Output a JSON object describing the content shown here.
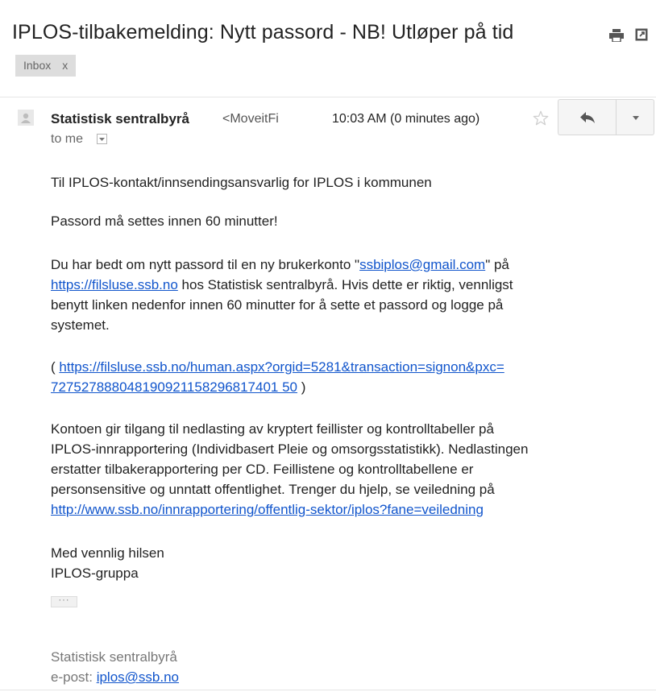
{
  "subject": "IPLOS-tilbakemelding: Nytt passord - NB! Utløper på tid",
  "labels": [
    {
      "name": "Inbox",
      "remove": "x"
    }
  ],
  "icons": {
    "print": "print-icon",
    "popout": "new-window-icon",
    "avatar": "avatar-icon",
    "star": "star-icon",
    "reply": "reply-icon",
    "more": "chevron-down-icon"
  },
  "sender": {
    "name": "Statistisk sentralbyrå",
    "email_partial": "<MoveitFi",
    "time": "10:03 AM (0 minutes ago)",
    "to": "to me"
  },
  "body": {
    "greeting": "Til IPLOS-kontakt/innsendingsansvarlig for IPLOS i kommunen",
    "warning": "Passord må settes innen 60 minutter!",
    "p1_a": "Du har bedt om nytt passord til en ny brukerkonto \"",
    "p1_email": "ssbiplos@gmail.com",
    "p1_b": "\" på",
    "p1_url": "https://filsluse.ssb.no",
    "p1_c": " hos Statistisk sentralbyrå. Hvis dette er riktig, vennligst",
    "p1_line3": "benytt linken nedenfor innen 60 minutter for å sette et passord og logge på",
    "p1_line4": "systemet.",
    "link_open": "( ",
    "link_line1": "https://filsluse.ssb.no/human.aspx?orgid=5281&transaction=signon&pxc=",
    "link_line2": "727527888048190921158296817401 50",
    "link_close": " )",
    "p3_line1": "Kontoen gir tilgang til nedlasting av kryptert feillister og kontrolltabeller på",
    "p3_line2": "IPLOS-innrapportering (Individbasert Pleie og omsorgsstatistikk). Nedlastingen",
    "p3_line3": "erstatter tilbakerapportering per CD. Feillistene og kontrolltabellene er",
    "p3_line4": "personsensitive og unntatt offentlighet. Trenger du hjelp, se veiledning på",
    "p3_url": "http://www.ssb.no/innrapportering/offentlig-sektor/iplos?fane=veiledning",
    "closing": "Med vennlig hilsen",
    "team": "IPLOS-gruppa",
    "show_trimmed": "···"
  },
  "signature": {
    "org": "Statistisk sentralbyrå",
    "email_label": "e-post: ",
    "email": "iplos@ssb.no"
  }
}
